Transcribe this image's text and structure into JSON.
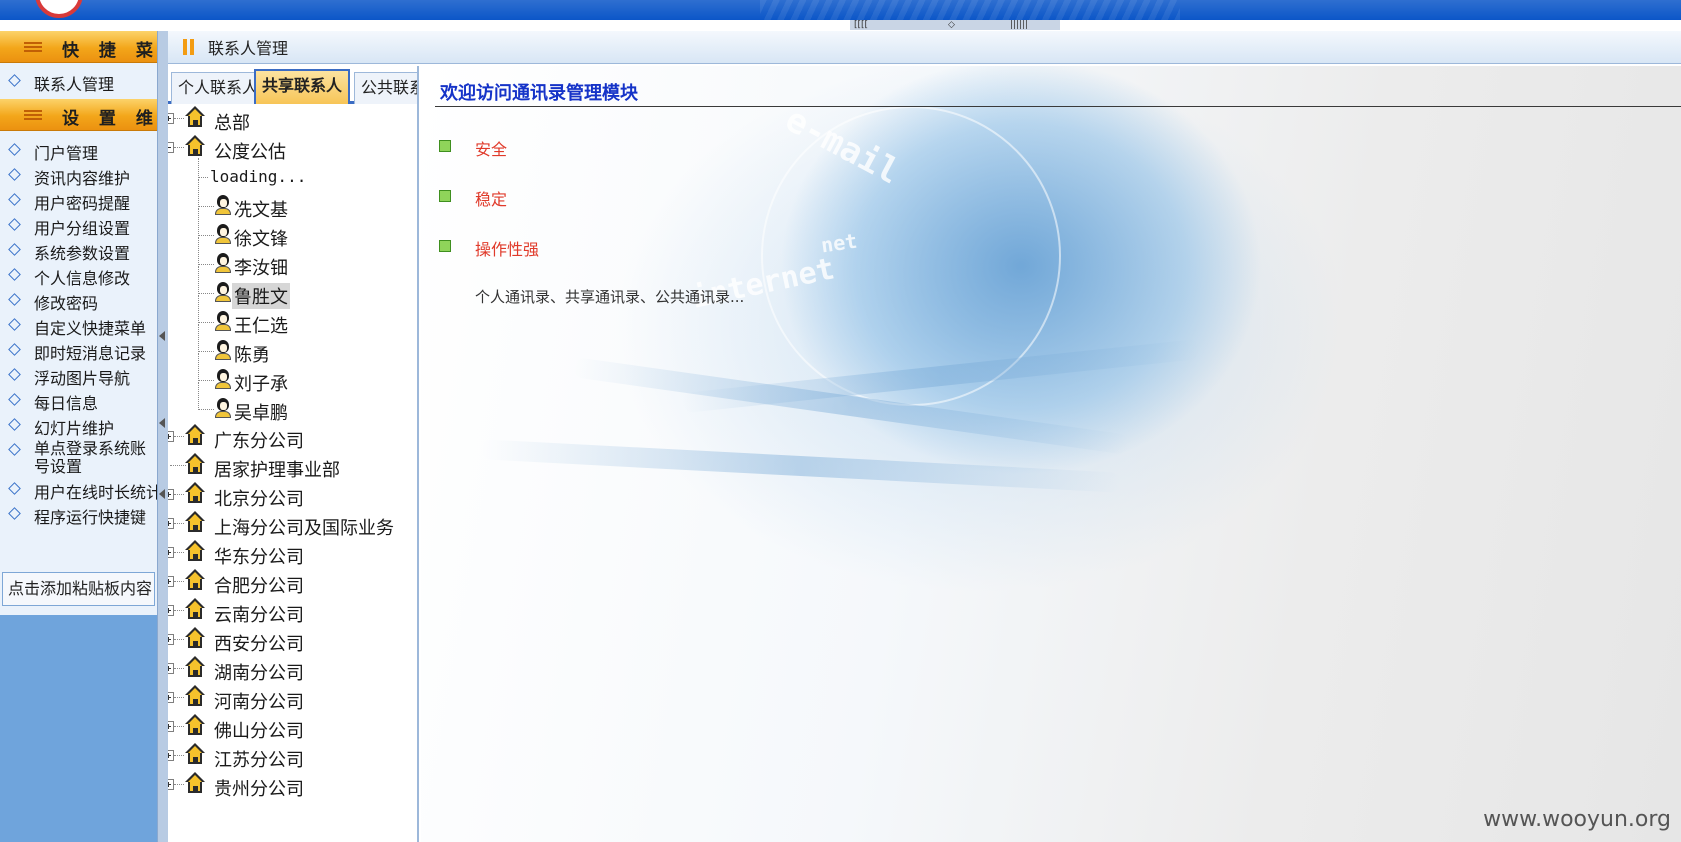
{
  "top": {
    "controls": [
      "[[[[",
      "◇",
      "||||||"
    ]
  },
  "sidebar": {
    "quick_menu_title": "快 捷 菜 单",
    "quick_items": [
      {
        "label": "联系人管理"
      }
    ],
    "settings_title": "设 置 维 护",
    "settings_items": [
      {
        "label": "门户管理"
      },
      {
        "label": "资讯内容维护"
      },
      {
        "label": "用户密码提醒"
      },
      {
        "label": "用户分组设置"
      },
      {
        "label": "系统参数设置"
      },
      {
        "label": "个人信息修改"
      },
      {
        "label": "修改密码"
      },
      {
        "label": "自定义快捷菜单"
      },
      {
        "label": "即时短消息记录"
      },
      {
        "label": "浮动图片导航"
      },
      {
        "label": "每日信息"
      },
      {
        "label": "幻灯片维护"
      },
      {
        "label": "单点登录系统账号设置"
      },
      {
        "label": "用户在线时长统计"
      },
      {
        "label": "程序运行快捷键"
      }
    ],
    "clipboard_label": "点击添加粘贴板内容"
  },
  "titlebar": {
    "title": "联系人管理"
  },
  "tabs": [
    {
      "label": "个人联系人"
    },
    {
      "label": "共享联系人",
      "active": true
    },
    {
      "label": "公共联系人"
    }
  ],
  "tree": {
    "nodes": [
      {
        "label": "总部",
        "type": "branch",
        "expander": "plus"
      },
      {
        "label": "公度公估",
        "type": "branch",
        "expander": "minus"
      },
      {
        "label": "loading...",
        "type": "loading"
      },
      {
        "label": "冼文基",
        "type": "person"
      },
      {
        "label": "徐文锋",
        "type": "person"
      },
      {
        "label": "李汝钿",
        "type": "person"
      },
      {
        "label": "鲁胜文",
        "type": "person",
        "selected": true
      },
      {
        "label": "王仁选",
        "type": "person"
      },
      {
        "label": "陈勇",
        "type": "person"
      },
      {
        "label": "刘子承",
        "type": "person"
      },
      {
        "label": "吴卓鹏",
        "type": "person"
      },
      {
        "label": "广东分公司",
        "type": "branch",
        "expander": "plus"
      },
      {
        "label": "居家护理事业部",
        "type": "branch",
        "expander": "none"
      },
      {
        "label": "北京分公司",
        "type": "branch",
        "expander": "plus"
      },
      {
        "label": "上海分公司及国际业务",
        "type": "branch",
        "expander": "plus"
      },
      {
        "label": "华东分公司",
        "type": "branch",
        "expander": "plus"
      },
      {
        "label": "合肥分公司",
        "type": "branch",
        "expander": "plus"
      },
      {
        "label": "云南分公司",
        "type": "branch",
        "expander": "plus"
      },
      {
        "label": "西安分公司",
        "type": "branch",
        "expander": "plus"
      },
      {
        "label": "湖南分公司",
        "type": "branch",
        "expander": "plus"
      },
      {
        "label": "河南分公司",
        "type": "branch",
        "expander": "plus"
      },
      {
        "label": "佛山分公司",
        "type": "branch",
        "expander": "plus"
      },
      {
        "label": "江苏分公司",
        "type": "branch",
        "expander": "plus"
      },
      {
        "label": "贵州分公司",
        "type": "branch",
        "expander": "plus"
      }
    ]
  },
  "main": {
    "welcome": "欢迎访问通讯录管理模块",
    "features": [
      {
        "label": "安全"
      },
      {
        "label": "稳定"
      },
      {
        "label": "操作性强"
      }
    ],
    "description": "个人通讯录、共享通讯录、公共通讯录...",
    "decor_text": [
      "e-mail",
      "net",
      "internet"
    ]
  },
  "watermark": "www.wooyun.org",
  "colors": {
    "accent_orange": "#f3a61a",
    "tab_border_blue": "#3b6cc4",
    "welcome_blue": "#1533c8",
    "feature_red": "#e03a2a",
    "feature_green": "#8fd45a"
  }
}
